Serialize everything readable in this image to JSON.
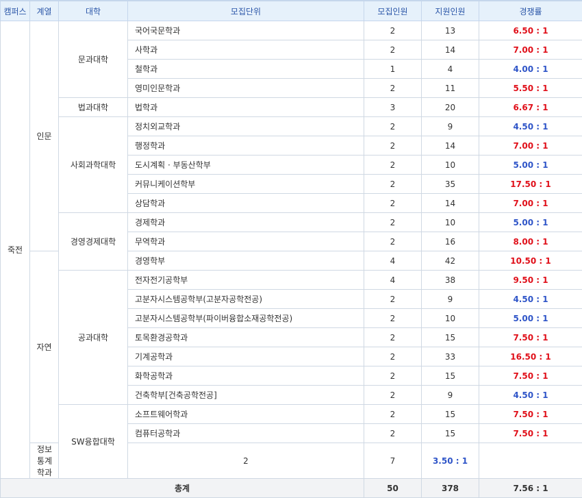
{
  "headers": [
    "캠퍼스",
    "계열",
    "대학",
    "모집단위",
    "모집인원",
    "지원인원",
    "경쟁률"
  ],
  "campus": "죽전",
  "series": [
    {
      "name": "인문",
      "rowspan": 12
    },
    {
      "name": "자연",
      "rowspan": 10
    }
  ],
  "colleges": [
    {
      "name": "문과대학",
      "rowspan": 4
    },
    {
      "name": "법과대학",
      "rowspan": 1
    },
    {
      "name": "사회과학대학",
      "rowspan": 5
    },
    {
      "name": "경영경제대학",
      "rowspan": 3
    },
    {
      "name": "공과대학",
      "rowspan": 7
    },
    {
      "name": "SW융합대학",
      "rowspan": 3
    }
  ],
  "rows": [
    {
      "unit": "국어국문학과",
      "quota": "2",
      "applicants": "13",
      "ratio": "6.50 : 1",
      "tone": "red"
    },
    {
      "unit": "사학과",
      "quota": "2",
      "applicants": "14",
      "ratio": "7.00 : 1",
      "tone": "red"
    },
    {
      "unit": "철학과",
      "quota": "1",
      "applicants": "4",
      "ratio": "4.00 : 1",
      "tone": "blue"
    },
    {
      "unit": "영미인문학과",
      "quota": "2",
      "applicants": "11",
      "ratio": "5.50 : 1",
      "tone": "red"
    },
    {
      "unit": "법학과",
      "quota": "3",
      "applicants": "20",
      "ratio": "6.67 : 1",
      "tone": "red"
    },
    {
      "unit": "정치외교학과",
      "quota": "2",
      "applicants": "9",
      "ratio": "4.50 : 1",
      "tone": "blue"
    },
    {
      "unit": "행정학과",
      "quota": "2",
      "applicants": "14",
      "ratio": "7.00 : 1",
      "tone": "red"
    },
    {
      "unit": "도시계획 · 부동산학부",
      "quota": "2",
      "applicants": "10",
      "ratio": "5.00 : 1",
      "tone": "blue"
    },
    {
      "unit": "커뮤니케이션학부",
      "quota": "2",
      "applicants": "35",
      "ratio": "17.50 : 1",
      "tone": "red"
    },
    {
      "unit": "상담학과",
      "quota": "2",
      "applicants": "14",
      "ratio": "7.00 : 1",
      "tone": "red"
    },
    {
      "unit": "경제학과",
      "quota": "2",
      "applicants": "10",
      "ratio": "5.00 : 1",
      "tone": "blue"
    },
    {
      "unit": "무역학과",
      "quota": "2",
      "applicants": "16",
      "ratio": "8.00 : 1",
      "tone": "red"
    },
    {
      "unit": "경영학부",
      "quota": "4",
      "applicants": "42",
      "ratio": "10.50 : 1",
      "tone": "red"
    },
    {
      "unit": "전자전기공학부",
      "quota": "4",
      "applicants": "38",
      "ratio": "9.50 : 1",
      "tone": "red"
    },
    {
      "unit": "고분자시스템공학부(고분자공학전공)",
      "quota": "2",
      "applicants": "9",
      "ratio": "4.50 : 1",
      "tone": "blue"
    },
    {
      "unit": "고분자시스템공학부(파이버융합소재공학전공)",
      "quota": "2",
      "applicants": "10",
      "ratio": "5.00 : 1",
      "tone": "blue"
    },
    {
      "unit": "토목환경공학과",
      "quota": "2",
      "applicants": "15",
      "ratio": "7.50 : 1",
      "tone": "red"
    },
    {
      "unit": "기계공학과",
      "quota": "2",
      "applicants": "33",
      "ratio": "16.50 : 1",
      "tone": "red"
    },
    {
      "unit": "화학공학과",
      "quota": "2",
      "applicants": "15",
      "ratio": "7.50 : 1",
      "tone": "red"
    },
    {
      "unit": "건축학부[건축공학전공]",
      "quota": "2",
      "applicants": "9",
      "ratio": "4.50 : 1",
      "tone": "blue"
    },
    {
      "unit": "소프트웨어학과",
      "quota": "2",
      "applicants": "15",
      "ratio": "7.50 : 1",
      "tone": "red"
    },
    {
      "unit": "컴퓨터공학과",
      "quota": "2",
      "applicants": "15",
      "ratio": "7.50 : 1",
      "tone": "red"
    },
    {
      "unit": "정보통계학과",
      "quota": "2",
      "applicants": "7",
      "ratio": "3.50 : 1",
      "tone": "blue"
    }
  ],
  "total": {
    "label": "총계",
    "quota": "50",
    "applicants": "378",
    "ratio": "7.56 : 1"
  },
  "colors": {
    "red": "#e0101a",
    "blue": "#2f55c8",
    "header_bg": "#e6f1fb",
    "header_text": "#2b56a8",
    "accent": "#3d7fd6"
  }
}
